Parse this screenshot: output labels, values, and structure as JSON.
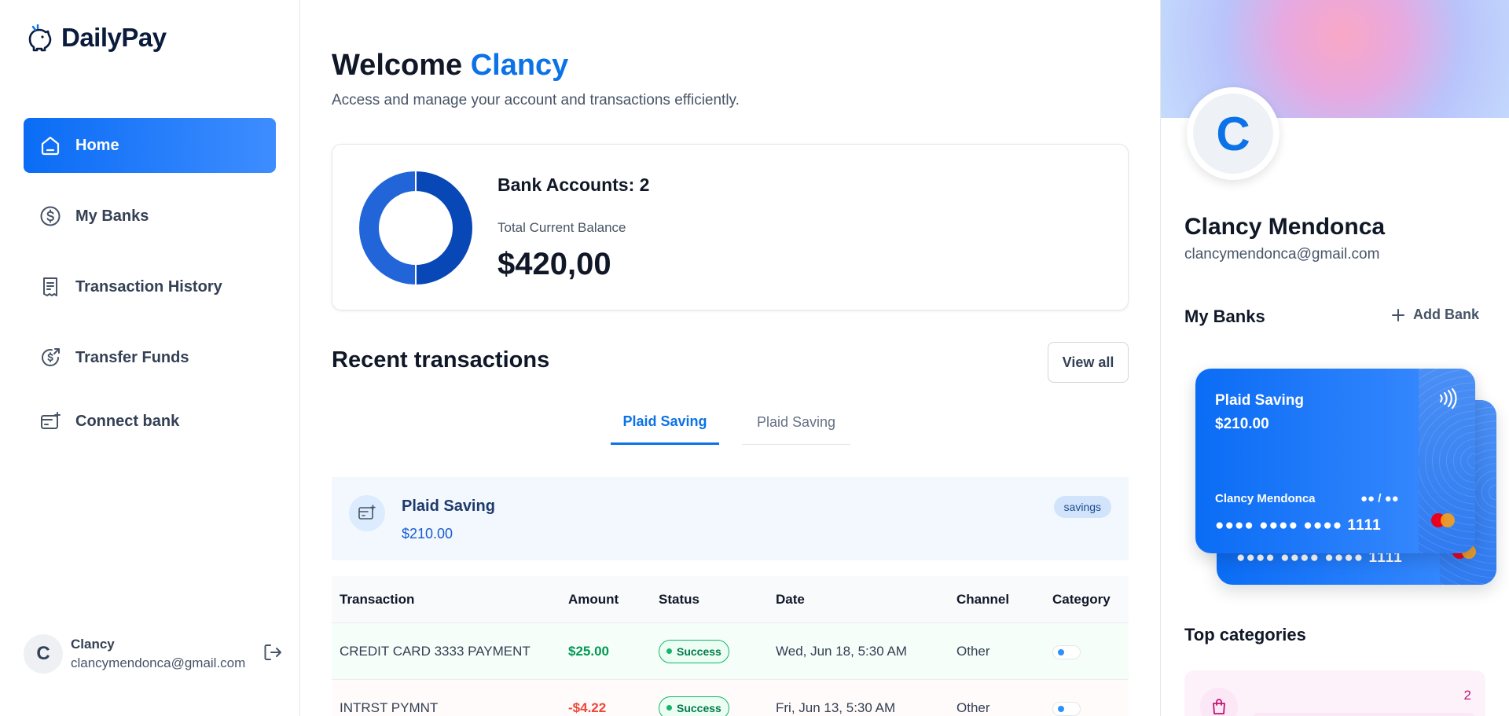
{
  "app": {
    "name": "DailyPay"
  },
  "sidebar": {
    "items": [
      {
        "label": "Home",
        "icon": "home-icon",
        "active": true
      },
      {
        "label": "My Banks",
        "icon": "dollar-circle-icon",
        "active": false
      },
      {
        "label": "Transaction History",
        "icon": "receipt-icon",
        "active": false
      },
      {
        "label": "Transfer Funds",
        "icon": "money-send-icon",
        "active": false
      },
      {
        "label": "Connect bank",
        "icon": "card-add-icon",
        "active": false
      }
    ],
    "footer": {
      "avatar_initial": "C",
      "name": "Clancy",
      "email": "clancymendonca@gmail.com"
    }
  },
  "header": {
    "welcome_prefix": "Welcome",
    "user_first_name": "Clancy",
    "subtitle": "Access and manage your account and transactions efficiently."
  },
  "balance": {
    "bank_accounts_label": "Bank Accounts: 2",
    "total_label": "Total Current Balance",
    "total_value": "$420,00",
    "donut_shares": [
      210,
      210
    ],
    "donut_colors": [
      "#0747b6",
      "#2265d8"
    ]
  },
  "recent": {
    "title": "Recent transactions",
    "view_all_label": "View all",
    "tabs": [
      {
        "label": "Plaid Saving",
        "active": true
      },
      {
        "label": "Plaid Saving",
        "active": false
      }
    ],
    "bank_banner": {
      "name": "Plaid Saving",
      "amount": "$210.00",
      "badge": "savings"
    },
    "columns": [
      "Transaction",
      "Amount",
      "Status",
      "Date",
      "Channel",
      "Category"
    ],
    "rows": [
      {
        "name": "CREDIT CARD 3333 PAYMENT",
        "amount": "$25.00",
        "type": "pos",
        "status": "Success",
        "date": "Wed, Jun 18, 5:30 AM",
        "channel": "Other"
      },
      {
        "name": "INTRST PYMNT",
        "amount": "-$4.22",
        "type": "neg",
        "status": "Success",
        "date": "Fri, Jun 13, 5:30 AM",
        "channel": "Other"
      }
    ]
  },
  "profile": {
    "avatar_initial": "C",
    "name": "Clancy Mendonca",
    "email": "clancymendonca@gmail.com",
    "my_banks_label": "My Banks",
    "add_bank_label": "Add Bank"
  },
  "cards": [
    {
      "title": "Plaid Saving",
      "amount": "$210.00",
      "holder": "Clancy Mendonca",
      "expiry": "●● / ●●",
      "number": "●●●● ●●●● ●●●● 1111"
    },
    {
      "number": "●●●● ●●●● ●●●● 1111"
    }
  ],
  "top_categories": {
    "title": "Top categories",
    "items": [
      {
        "icon": "shopping-bag-icon",
        "count": "2"
      }
    ]
  }
}
